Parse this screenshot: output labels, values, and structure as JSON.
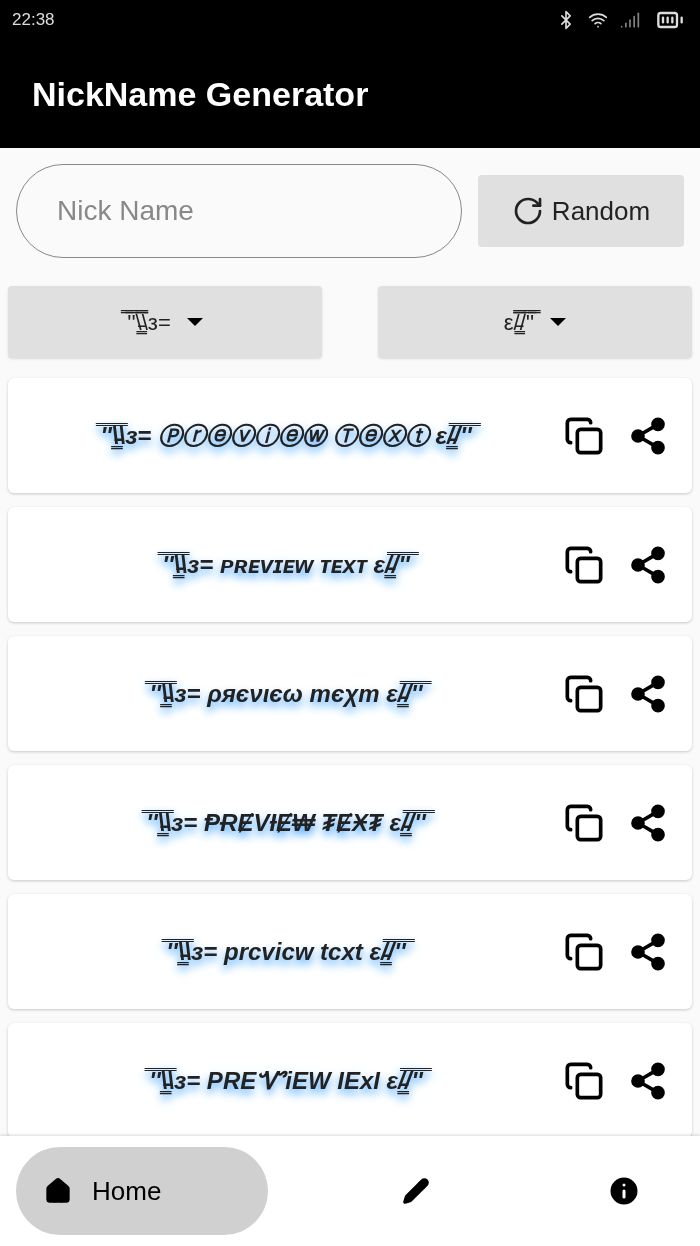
{
  "status_bar": {
    "time": "22:38"
  },
  "app_bar": {
    "title": "NickName Generator"
  },
  "search": {
    "placeholder": "Nick Name"
  },
  "random_button": {
    "label": "Random"
  },
  "dropdowns": [
    {
      "value": "̿'̿'\\̵͇̿̿\\з="
    },
    {
      "value": "ε/̵͇̿̿/'̿'̿"
    }
  ],
  "previews": [
    {
      "text": "̿'̿'\\̵͇̿̿\\з= Ⓟⓡⓔⓥⓘⓔⓦ Ⓣⓔⓧⓣ ε/̵͇̿̿/'̿'̿"
    },
    {
      "text": "̿'̿'\\̵͇̿̿\\з= ᴘʀᴇᴠɪᴇᴡ ᴛᴇxᴛ ε/̵͇̿̿/'̿'̿"
    },
    {
      "text": "̿'̿'\\̵͇̿̿\\з= ρяєνιєω тєχт ε/̵͇̿̿/'̿'̿"
    },
    {
      "text": "̿'̿'\\̵͇̿̿\\з= ⱣɌɆVƗɆ₩ ₮ɆӾ₮ ε/̵͇̿̿/'̿'̿"
    },
    {
      "text": "̿'̿'\\̵͇̿̿\\з= prcvicw tcxt ε/̵͇̿̿/'̿'̿"
    },
    {
      "text": "̿'̿'\\̵͇̿̿\\з= PREᏉiEW ƖExƖ ε/̵͇̿̿/'̿'̿"
    }
  ],
  "bottom_nav": [
    {
      "kind": "home",
      "label": "Home",
      "selected": true
    },
    {
      "kind": "edit",
      "selected": false
    },
    {
      "kind": "info",
      "selected": false
    }
  ]
}
